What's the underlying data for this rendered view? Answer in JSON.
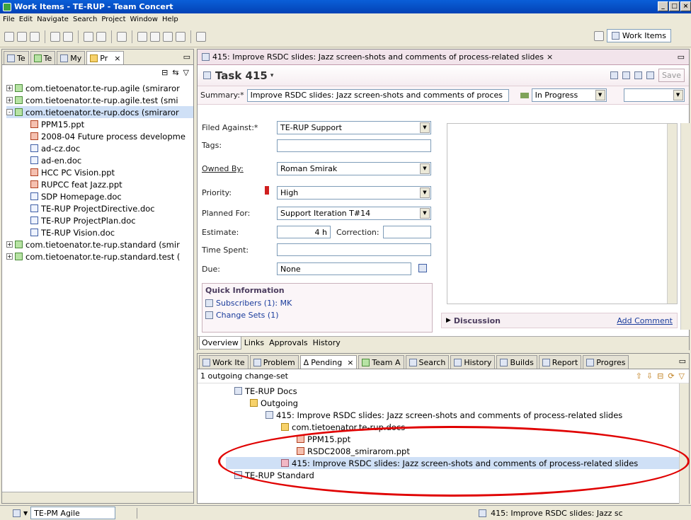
{
  "window": {
    "title": "Work Items - TE-RUP - Team Concert"
  },
  "menu": [
    "File",
    "Edit",
    "Navigate",
    "Search",
    "Project",
    "Window",
    "Help"
  ],
  "perspective": {
    "label": "Work Items"
  },
  "left_tabs": [
    "Te",
    "Te",
    "My",
    "Pr"
  ],
  "tree": [
    {
      "label": "com.tietoenator.te-rup.agile (smiraror",
      "indent": 0,
      "icon": "project",
      "expander": "+"
    },
    {
      "label": "com.tietoenator.te-rup.agile.test (smi",
      "indent": 0,
      "icon": "project",
      "expander": "+"
    },
    {
      "label": "com.tietoenator.te-rup.docs (smiraror",
      "indent": 0,
      "icon": "project",
      "expander": "-",
      "selected": true
    },
    {
      "label": "PPM15.ppt",
      "indent": 1,
      "icon": "ppt"
    },
    {
      "label": "2008-04 Future process developme",
      "indent": 1,
      "icon": "ppt"
    },
    {
      "label": "ad-cz.doc",
      "indent": 1,
      "icon": "doc"
    },
    {
      "label": "ad-en.doc",
      "indent": 1,
      "icon": "doc"
    },
    {
      "label": "HCC PC Vision.ppt",
      "indent": 1,
      "icon": "ppt"
    },
    {
      "label": "RUPCC feat Jazz.ppt",
      "indent": 1,
      "icon": "ppt"
    },
    {
      "label": "SDP Homepage.doc",
      "indent": 1,
      "icon": "doc"
    },
    {
      "label": "TE-RUP ProjectDirective.doc",
      "indent": 1,
      "icon": "doc"
    },
    {
      "label": "TE-RUP ProjectPlan.doc",
      "indent": 1,
      "icon": "doc"
    },
    {
      "label": "TE-RUP Vision.doc",
      "indent": 1,
      "icon": "doc"
    },
    {
      "label": "com.tietoenator.te-rup.standard (smir",
      "indent": 0,
      "icon": "project",
      "expander": "+"
    },
    {
      "label": "com.tietoenator.te-rup.standard.test (",
      "indent": 0,
      "icon": "project",
      "expander": "+"
    }
  ],
  "editor": {
    "tab": "415: Improve RSDC slides: Jazz screen-shots and comments of process-related slides",
    "task_title": "Task 415",
    "save": "Save",
    "summary_label": "Summary:*",
    "summary_value": "Improve RSDC slides: Jazz screen-shots and comments of proces",
    "state": "In Progress",
    "fields": {
      "filed_against_label": "Filed Against:*",
      "filed_against": "TE-RUP Support",
      "tags_label": "Tags:",
      "owned_by_label": "Owned By:",
      "owned_by": "Roman Smirak",
      "priority_label": "Priority:",
      "priority": "High",
      "planned_for_label": "Planned For:",
      "planned_for": "Support Iteration T#14",
      "estimate_label": "Estimate:",
      "estimate": "4 h",
      "correction_label": "Correction:",
      "time_spent_label": "Time Spent:",
      "due_label": "Due:",
      "due": "None"
    },
    "quick_info": {
      "title": "Quick Information",
      "subscribers": "Subscribers (1): MK",
      "change_sets": "Change Sets (1)"
    },
    "discussion": "Discussion",
    "add_comment": "Add Comment",
    "bottom_tabs": [
      "Overview",
      "Links",
      "Approvals",
      "History"
    ]
  },
  "bottom_panel": {
    "tabs": [
      "Work Ite",
      "Problem",
      "Pending",
      "Team A",
      "Search",
      "History",
      "Builds",
      "Report",
      "Progres"
    ],
    "header": "1 outgoing change-set",
    "rows": [
      {
        "label": "TE-RUP Docs",
        "indent": 0,
        "icon": "component"
      },
      {
        "label": "Outgoing",
        "indent": 1,
        "icon": "folder"
      },
      {
        "label": "415: Improve RSDC slides: Jazz screen-shots and comments of process-related slides",
        "indent": 2,
        "icon": "changeset"
      },
      {
        "label": "com.tietoenator.te-rup.docs",
        "indent": 3,
        "icon": "folder"
      },
      {
        "label": "PPM15.ppt",
        "indent": 4,
        "icon": "ppt"
      },
      {
        "label": "RSDC2008_smirarom.ppt",
        "indent": 4,
        "icon": "ppt"
      },
      {
        "label": "415: Improve RSDC slides: Jazz screen-shots and comments of process-related slides",
        "indent": 3,
        "icon": "workitem",
        "selected": true
      },
      {
        "label": "TE-RUP Standard",
        "indent": 0,
        "icon": "component"
      }
    ]
  },
  "status": {
    "left_item": "TE-PM Agile",
    "right_item": "415: Improve RSDC slides: Jazz sc"
  }
}
